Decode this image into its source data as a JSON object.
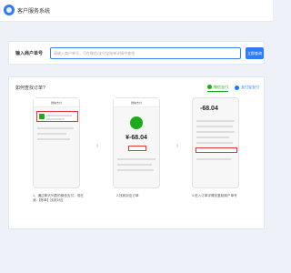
{
  "app": {
    "title": "客户服务系统"
  },
  "search": {
    "label": "输入商户单号",
    "placeholder": "请输入商户单号，可在微信/支付宝账单详情中查找",
    "button": "立即查询"
  },
  "guide": {
    "title": "如何查找订单?",
    "tabs": [
      {
        "label": "微信支付",
        "active": true,
        "color": "#1aad19"
      },
      {
        "label": "支付宝支付",
        "active": false,
        "color": "#1677ff"
      }
    ],
    "steps": [
      {
        "caption": "1、通过聊天列表的微信支付，或在我-【账单】找到对应",
        "phone_title": "微信支付"
      },
      {
        "caption": "2.找到对应订单",
        "phone_title": "微信支付",
        "amount": "¥-68.04"
      },
      {
        "caption": "3.进入订单详情页复制商户单号",
        "amount": "-68.04"
      }
    ],
    "arrow_glyph": "›"
  },
  "colors": {
    "accent": "#2f7cf6",
    "wechat": "#1aad19",
    "highlight": "#ee3333"
  }
}
